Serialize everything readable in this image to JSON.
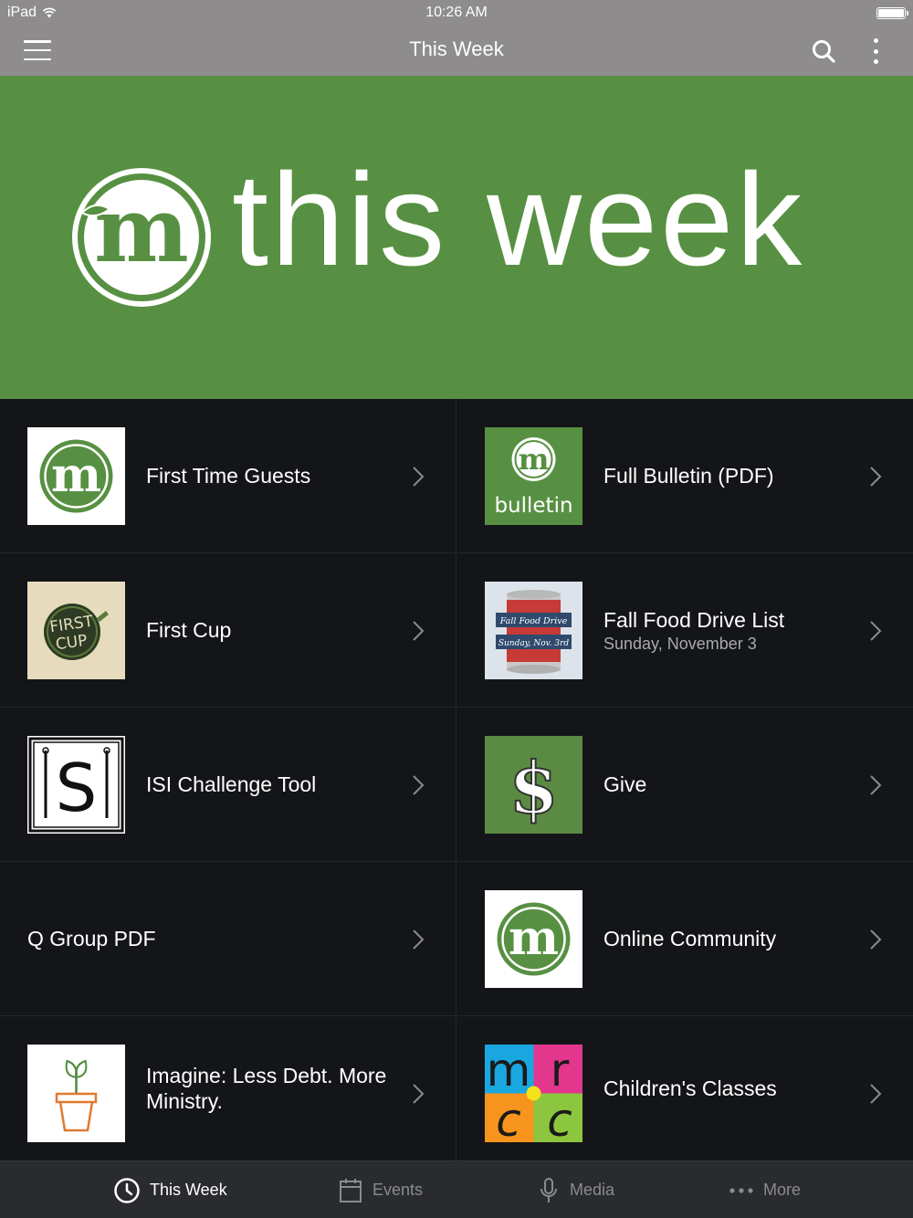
{
  "status": {
    "device": "iPad",
    "time": "10:26 AM"
  },
  "nav": {
    "title": "This Week"
  },
  "hero": {
    "title": "this week",
    "logo_letter": "m"
  },
  "items": [
    {
      "title": "First Time Guests",
      "thumb": "m-logo"
    },
    {
      "title": "Full Bulletin (PDF)",
      "thumb": "bulletin",
      "thumb_text": "bulletin",
      "thumb_letter": "m"
    },
    {
      "title": "First Cup",
      "thumb": "first-cup",
      "thumb_text": [
        "FIRST",
        "CUP"
      ]
    },
    {
      "title": "Fall Food Drive List",
      "subtitle": "Sunday, November 3",
      "thumb": "food-drive",
      "thumb_text": [
        "Fall Food Drive",
        "Sunday, Nov. 3rd"
      ]
    },
    {
      "title": "ISI Challenge Tool",
      "thumb": "isi",
      "thumb_text": "S"
    },
    {
      "title": "Give",
      "thumb": "dollar",
      "thumb_text": "$"
    },
    {
      "title": "Q Group PDF"
    },
    {
      "title": "Online Community",
      "thumb": "m-logo"
    },
    {
      "title": "Imagine: Less Debt. More Ministry.",
      "thumb": "plant-pot"
    },
    {
      "title": "Children's Classes",
      "thumb": "mrcc",
      "thumb_text": [
        "m",
        "r",
        "c",
        "c"
      ]
    }
  ],
  "tabs": [
    {
      "label": "This Week",
      "icon": "clock-icon",
      "active": true
    },
    {
      "label": "Events",
      "icon": "calendar-icon",
      "active": false
    },
    {
      "label": "Media",
      "icon": "microphone-icon",
      "active": false
    },
    {
      "label": "More",
      "icon": "more-dots-icon",
      "active": false
    }
  ],
  "colors": {
    "brand_green": "#579042",
    "bar_gray": "#8e8c8d",
    "background": "#141518",
    "tab_bar": "#2a2b2f"
  }
}
